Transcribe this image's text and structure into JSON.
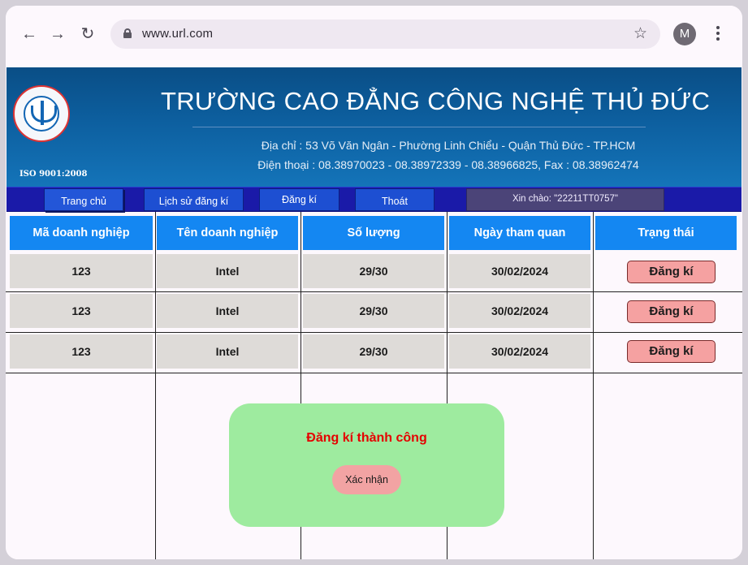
{
  "browser": {
    "url": "www.url.com",
    "avatar_letter": "M"
  },
  "header": {
    "school_name": "TRƯỜNG CAO ĐẲNG CÔNG NGHỆ THỦ ĐỨC",
    "address": "Địa chỉ : 53 Võ Văn Ngân - Phường Linh Chiểu - Quận Thủ Đức - TP.HCM",
    "phone": "Điện thoại : 08.38970023 - 08.38972339 - 08.38966825, Fax : 08.38962474",
    "iso": "ISO 9001:2008"
  },
  "nav": {
    "home": "Trang chủ",
    "history": "Lịch sử đăng kí",
    "register": "Đăng kí",
    "logout": "Thoát",
    "greeting": "Xin chào: \"22211TT0757\""
  },
  "table": {
    "columns": [
      "Mã doanh nghiệp",
      "Tên doanh nghiệp",
      "Số lượng",
      "Ngày tham quan",
      "Trạng thái"
    ],
    "rows": [
      {
        "code": "123",
        "name": "Intel",
        "quantity": "29/30",
        "date": "30/02/2024",
        "status": "Đăng kí"
      },
      {
        "code": "123",
        "name": "Intel",
        "quantity": "29/30",
        "date": "30/02/2024",
        "status": "Đăng kí"
      },
      {
        "code": "123",
        "name": "Intel",
        "quantity": "29/30",
        "date": "30/02/2024",
        "status": "Đăng kí"
      }
    ]
  },
  "modal": {
    "message": "Đăng kí thành công",
    "confirm": "Xác nhận"
  },
  "colors": {
    "header_blue": "#1487f2",
    "navbar": "#1a1aa8",
    "modal_bg": "#9eeb9f",
    "modal_text": "#e50000",
    "status_button": "#f5a1a1"
  }
}
